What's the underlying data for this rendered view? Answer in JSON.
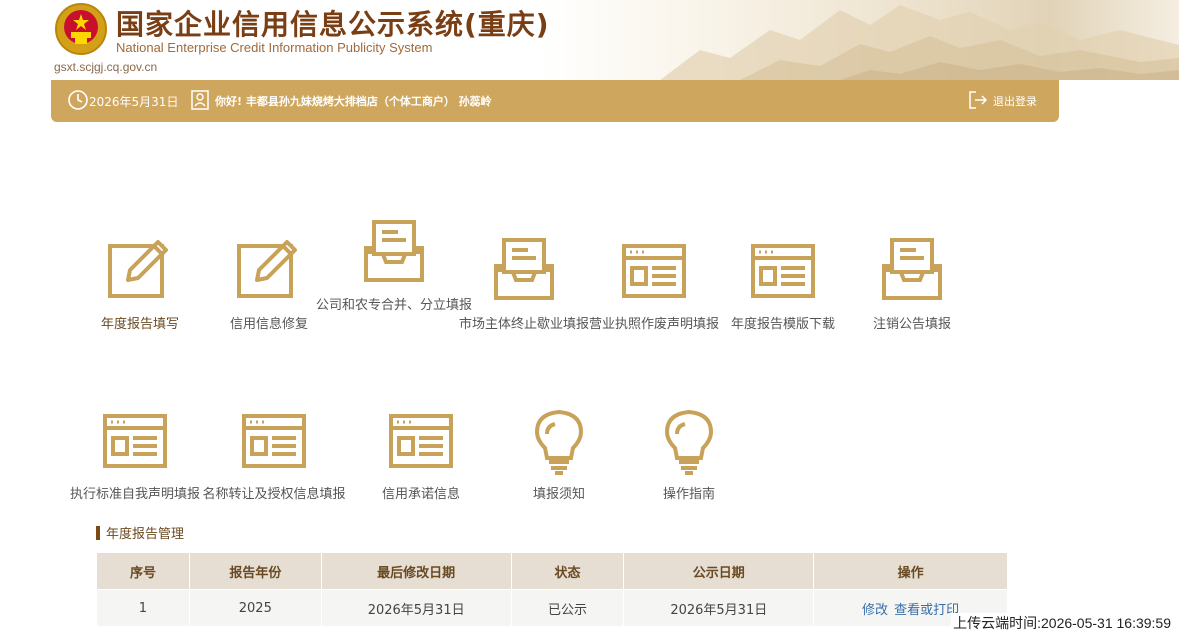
{
  "header": {
    "title_cn": "国家企业信用信息公示系统(重庆)",
    "title_en": "National Enterprise Credit Information Publicity System",
    "domain": "gsxt.scjgj.cq.gov.cn"
  },
  "topbar": {
    "date": "2026年5月31日",
    "greeting": "你好!  丰都县孙九妹烧烤大排档店（个体工商户）   孙蕊岭",
    "logout": "退出登录"
  },
  "tiles_row1": [
    {
      "label": "年度报告填写",
      "icon": "pencil-icon"
    },
    {
      "label": "信用信息修复",
      "icon": "pencil-icon"
    },
    {
      "label": "公司和农专合并、分立填报",
      "icon": "inbox-icon"
    },
    {
      "label": "市场主体终止歇业填报",
      "icon": "inbox-icon"
    },
    {
      "label": "营业执照作废声明填报",
      "icon": "browser-icon"
    },
    {
      "label": "年度报告模版下载",
      "icon": "browser-icon"
    },
    {
      "label": "注销公告填报",
      "icon": "inbox-icon"
    }
  ],
  "tiles_row2": [
    {
      "label": "执行标准自我声明填报",
      "icon": "browser-icon"
    },
    {
      "label": "名称转让及授权信息填报",
      "icon": "browser-icon"
    },
    {
      "label": "信用承诺信息",
      "icon": "browser-icon"
    },
    {
      "label": "填报须知",
      "icon": "lightbulb-icon"
    },
    {
      "label": "操作指南",
      "icon": "lightbulb-icon"
    }
  ],
  "section": {
    "title": "年度报告管理"
  },
  "table": {
    "headers": [
      "序号",
      "报告年份",
      "最后修改日期",
      "状态",
      "公示日期",
      "操作"
    ],
    "rows": [
      {
        "index": "1",
        "year": "2025",
        "modified": "2026年5月31日",
        "status": "已公示",
        "published": "2026年5月31日",
        "op_edit": "修改",
        "op_view": "查看或打印"
      }
    ]
  },
  "upload_time": "上传云端时间:2026-05-31 16:39:59",
  "colors": {
    "gold": "#cfa65d",
    "icon_gold": "#c9a25a",
    "brown": "#7a3e14",
    "link": "#3a6ea8"
  }
}
